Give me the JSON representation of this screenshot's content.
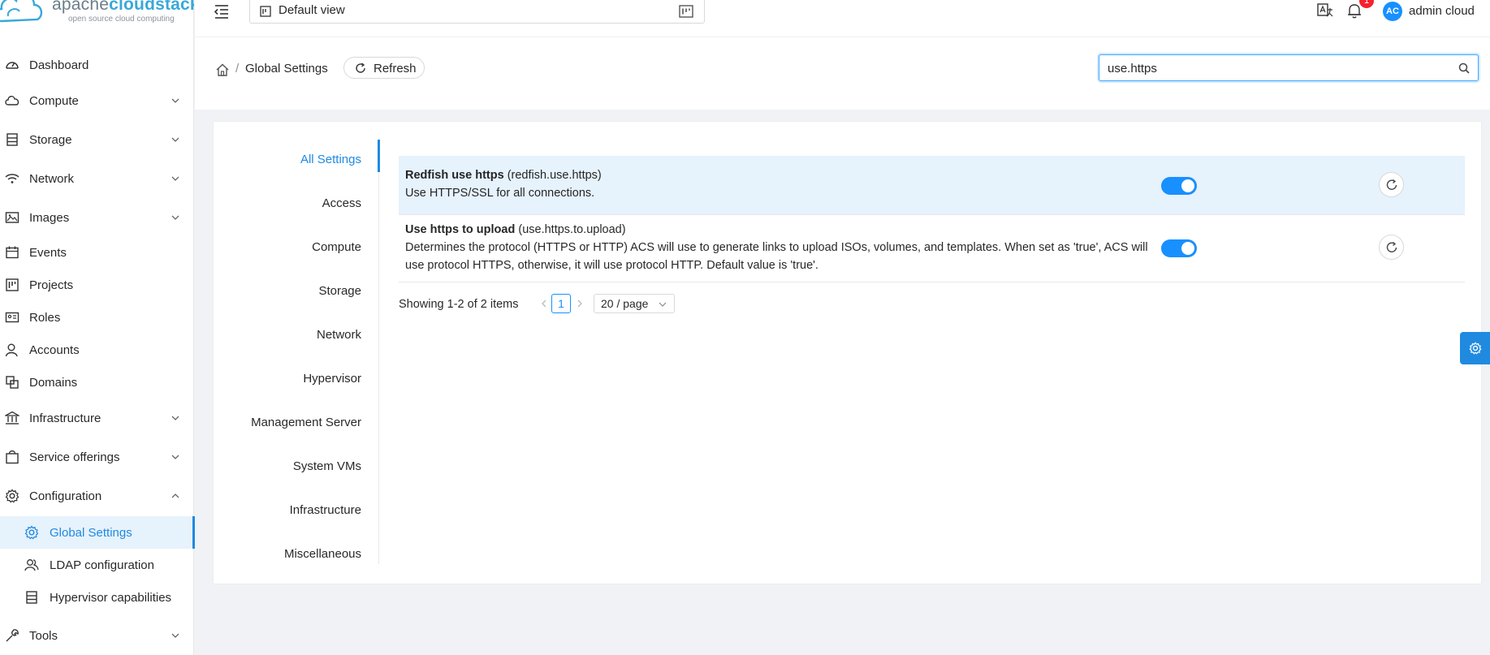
{
  "brand": {
    "name_prefix": "apache",
    "name_bold": "cloudstack",
    "tagline": "open source cloud computing"
  },
  "sidebar": {
    "items": [
      {
        "label": "Dashboard",
        "icon": "dashboard-icon"
      },
      {
        "label": "Compute",
        "icon": "cloud-icon"
      },
      {
        "label": "Storage",
        "icon": "database-icon"
      },
      {
        "label": "Network",
        "icon": "wifi-icon"
      },
      {
        "label": "Images",
        "icon": "picture-icon"
      },
      {
        "label": "Events",
        "icon": "calendar-icon"
      },
      {
        "label": "Projects",
        "icon": "project-icon"
      },
      {
        "label": "Roles",
        "icon": "idcard-icon"
      },
      {
        "label": "Accounts",
        "icon": "user-icon"
      },
      {
        "label": "Domains",
        "icon": "block-icon"
      },
      {
        "label": "Infrastructure",
        "icon": "bank-icon"
      },
      {
        "label": "Service offerings",
        "icon": "shopping-icon"
      },
      {
        "label": "Configuration",
        "icon": "setting-icon"
      },
      {
        "label": "Global Settings",
        "icon": "setting-icon"
      },
      {
        "label": "LDAP configuration",
        "icon": "team-icon"
      },
      {
        "label": "Hypervisor capabilities",
        "icon": "database-icon"
      },
      {
        "label": "Tools",
        "icon": "tool-icon"
      }
    ]
  },
  "topbar": {
    "view_label": "Default view",
    "notification_count": "1",
    "avatar_initials": "AC",
    "username": "admin cloud"
  },
  "breadcrumb": {
    "separator": "/",
    "title": "Global Settings",
    "refresh_label": "Refresh"
  },
  "search": {
    "value": "use.https"
  },
  "categories": [
    "All Settings",
    "Access",
    "Compute",
    "Storage",
    "Network",
    "Hypervisor",
    "Management Server",
    "System VMs",
    "Infrastructure",
    "Miscellaneous"
  ],
  "settings": [
    {
      "name": "Redfish use https",
      "key": "(redfish.use.https)",
      "description": "Use HTTPS/SSL for all connections.",
      "enabled": true
    },
    {
      "name": "Use https to upload",
      "key": "(use.https.to.upload)",
      "description": "Determines the protocol (HTTPS or HTTP) ACS will use to generate links to upload ISOs, volumes, and templates. When set as 'true', ACS will use protocol HTTPS, otherwise, it will use protocol HTTP. Default value is 'true'.",
      "enabled": true
    }
  ],
  "pagination": {
    "total_text": "Showing 1-2 of 2 items",
    "current_page": "1",
    "page_size": "20 / page"
  },
  "colors": {
    "accent": "#1f8ae0",
    "toggle_on": "#1890ff",
    "highlight_row": "#e6f2fc",
    "badge": "#f5222d"
  }
}
